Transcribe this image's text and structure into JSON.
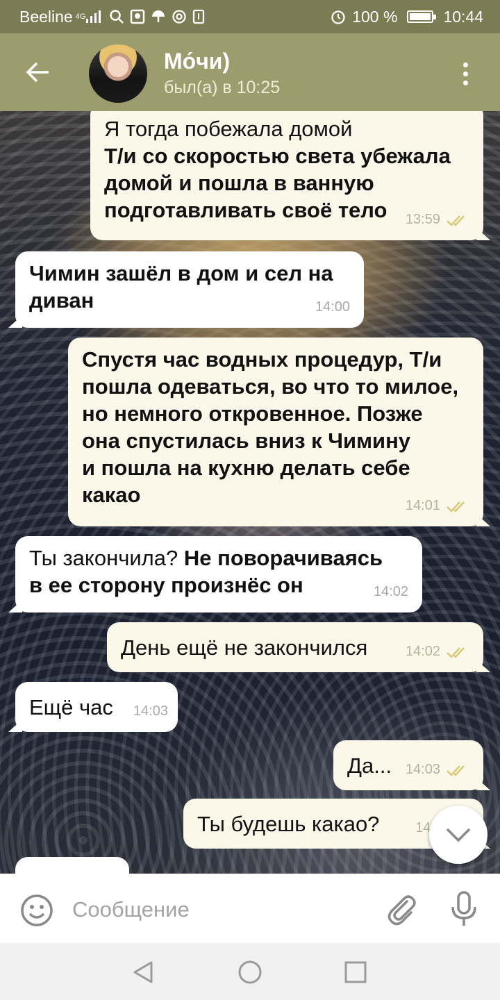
{
  "status_bar": {
    "carrier": "Beeline",
    "network": "4G",
    "battery": "100 %",
    "time": "10:44"
  },
  "header": {
    "name": "Мо́чи)",
    "status": "был(а) в 10:25"
  },
  "messages": [
    {
      "direction": "out",
      "lines": [
        "Я тогда побежала домой"
      ],
      "bold_lines": [
        "Т/и со скоростью света убежала",
        "домой и пошла в ванную",
        "подготавливать своё тело"
      ],
      "time": "13:59",
      "read": true
    },
    {
      "direction": "in",
      "lines": [],
      "bold_lines": [
        "Чимин зашёл в дом и сел на",
        "диван"
      ],
      "time": "14:00"
    },
    {
      "direction": "out",
      "lines": [],
      "bold_lines": [
        "Спустя час водных процедур, Т/и",
        "пошла одеваться, во что то милое,",
        "но немного откровенное. Позже",
        "она спустилась вниз к Чимину",
        "и пошла на кухню делать себе",
        "какао"
      ],
      "time": "14:01",
      "read": true
    },
    {
      "direction": "in",
      "plain": "Ты закончила?",
      "bold": "Не поворачиваясь",
      "bold2": "в ее сторону произнёс он",
      "time": "14:02"
    },
    {
      "direction": "out",
      "text": "День ещё не закончился",
      "time": "14:02",
      "read": true
    },
    {
      "direction": "in",
      "text": "Ещё час",
      "time": "14:03"
    },
    {
      "direction": "out",
      "text": "Да...",
      "time": "14:03",
      "read": true
    },
    {
      "direction": "out",
      "text": "Ты будешь какао?",
      "time": "14:"
    }
  ],
  "composer": {
    "placeholder": "Сообщение"
  },
  "colors": {
    "status_bar": "#7b7b54",
    "header": "#9c9c6e",
    "outgoing_bubble": "#fbf8ea",
    "incoming_bubble": "#ffffff",
    "read_check": "#d8c97a"
  },
  "icons": {
    "back": "arrow-left-icon",
    "menu": "more-vertical-icon",
    "scroll": "chevron-down-icon",
    "emoji": "smiley-icon",
    "attach": "paperclip-icon",
    "mic": "microphone-icon"
  }
}
